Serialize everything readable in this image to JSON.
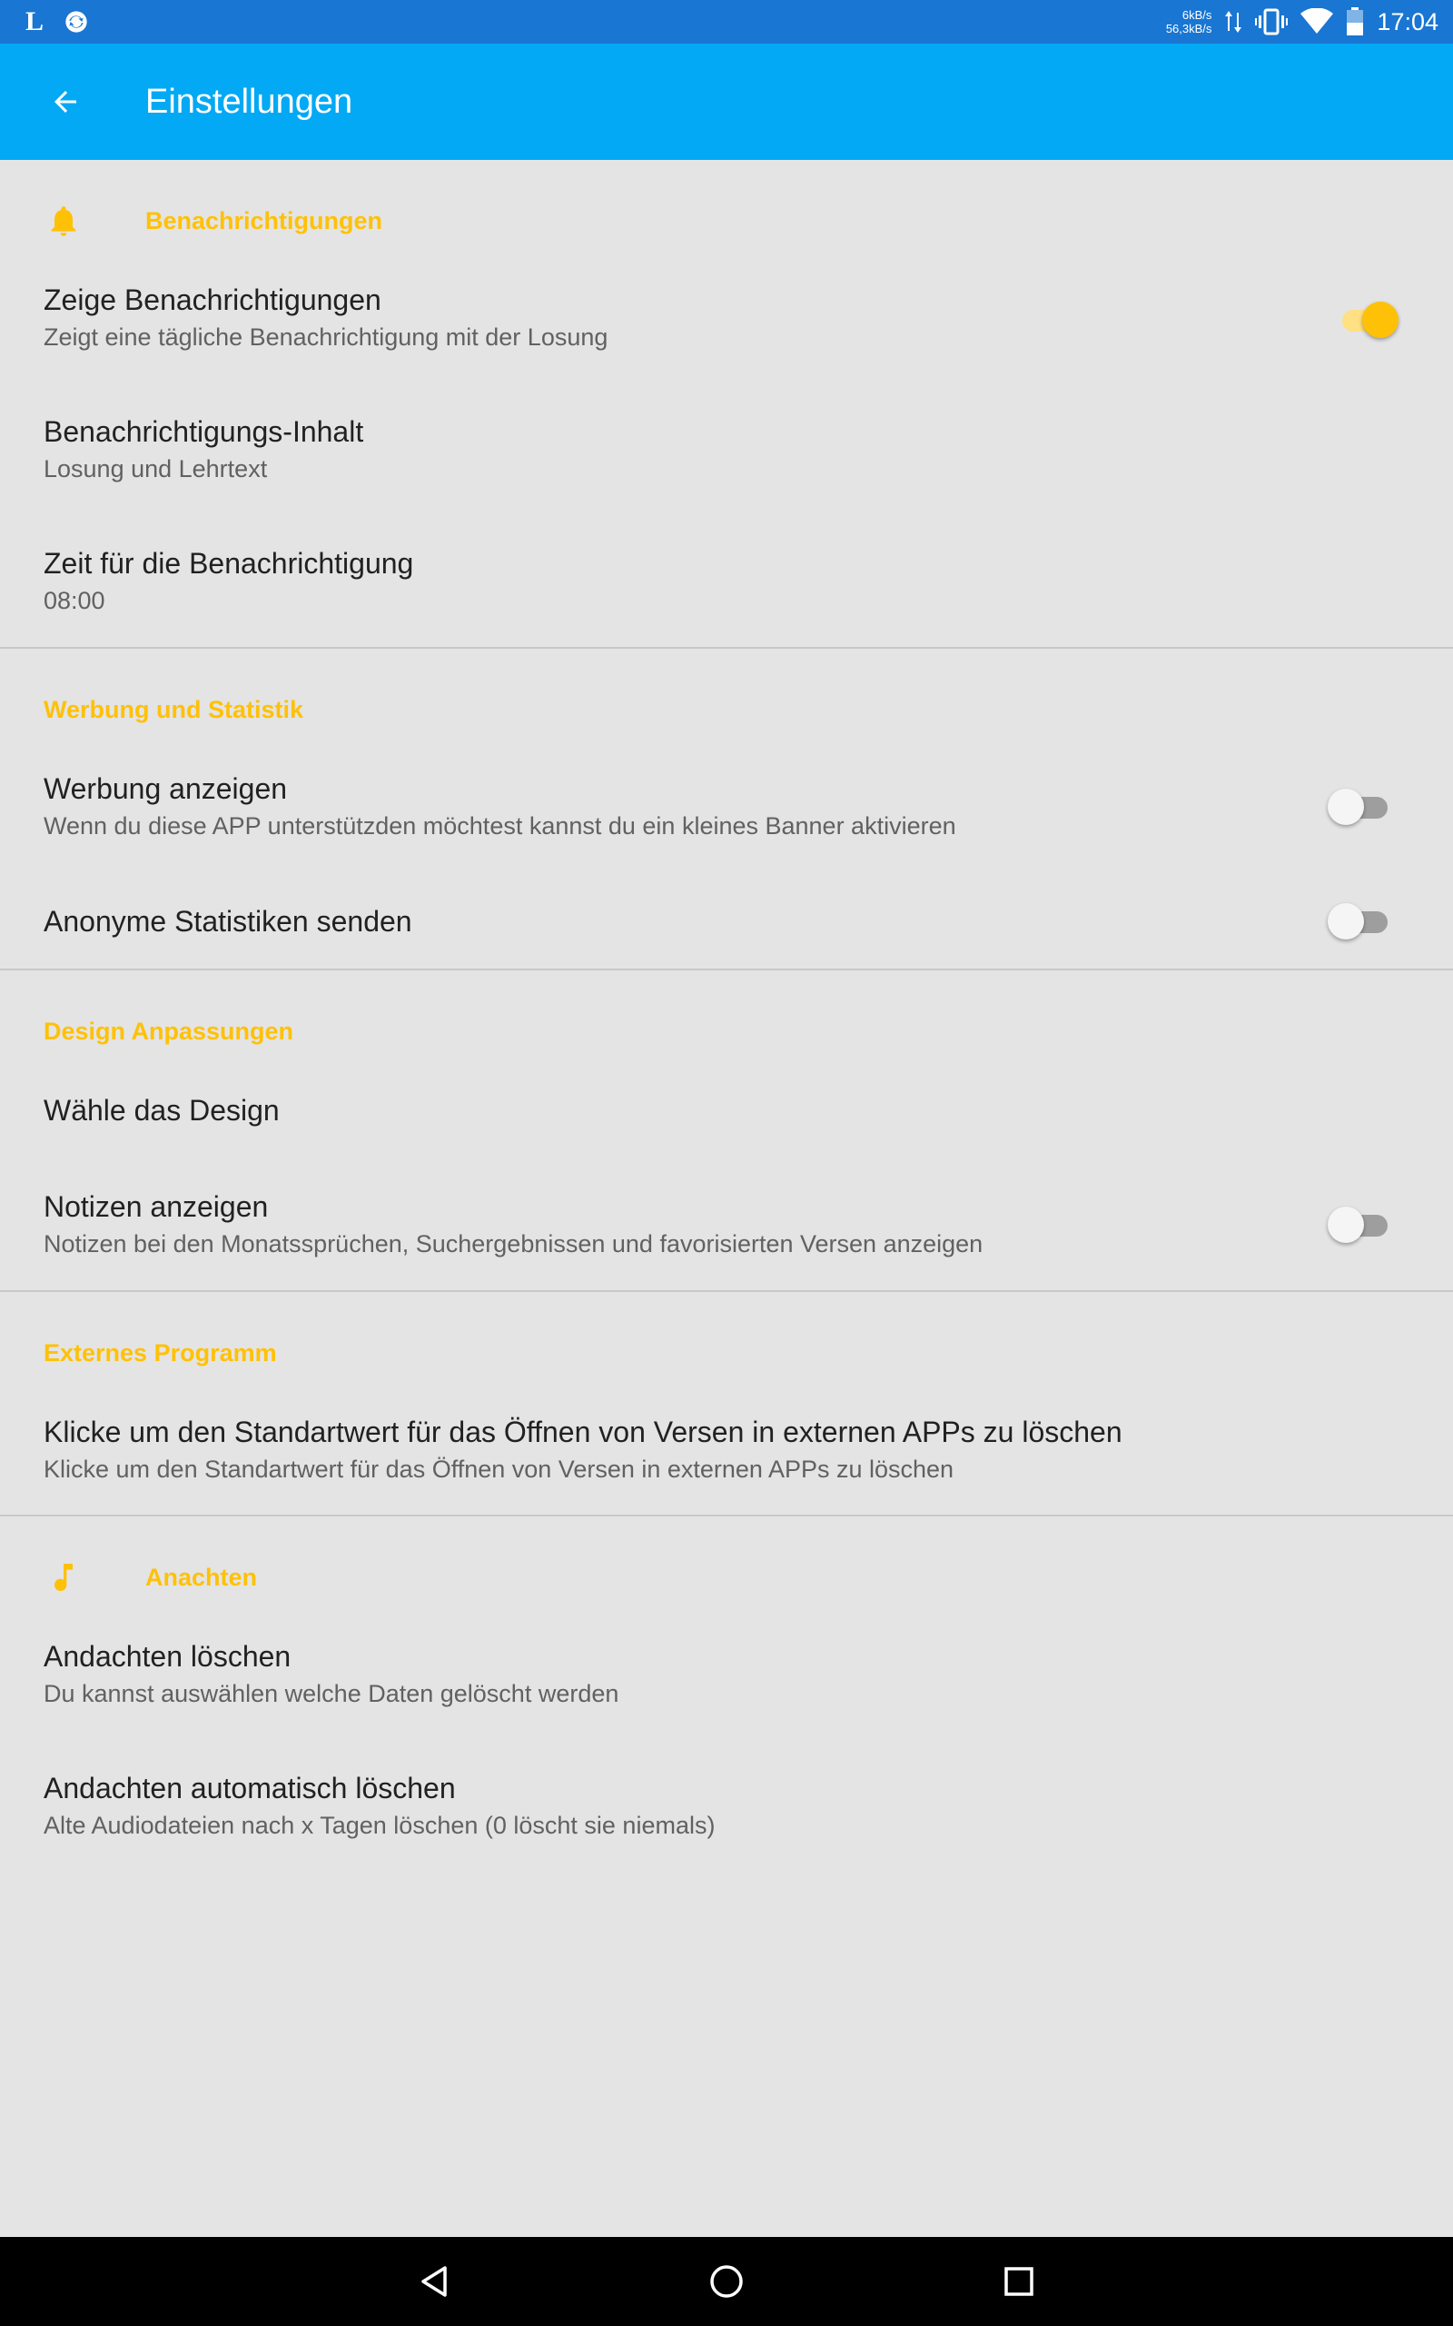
{
  "status_bar": {
    "left_icons": [
      "l-app-icon",
      "sync-icon"
    ],
    "speed_up": "6kB/s",
    "speed_down": "56,3kB/s",
    "icons": [
      "data-arrows-icon",
      "vibrate-icon",
      "wifi-icon",
      "battery-icon"
    ],
    "time": "17:04"
  },
  "app_bar": {
    "back_icon": "arrow-back-icon",
    "title": "Einstellungen",
    "background": "#03a9f4"
  },
  "accent_color": "#ffc107",
  "sections": {
    "notifications": {
      "header": "Benachrichtigungen",
      "icon": "bell-icon",
      "items": [
        {
          "title": "Zeige Benachrichtigungen",
          "summary": "Zeigt eine tägliche Benachrichtigung mit der Losung",
          "switch_on": true
        },
        {
          "title": "Benachrichtigungs-Inhalt",
          "summary": "Losung und Lehrtext"
        },
        {
          "title": "Zeit für die Benachrichtigung",
          "summary": "08:00"
        }
      ]
    },
    "ads": {
      "header": "Werbung und Statistik",
      "items": [
        {
          "title": "Werbung anzeigen",
          "summary": "Wenn du diese APP unterstützden möchtest kannst du ein kleines Banner aktivieren",
          "switch_on": false
        },
        {
          "title": "Anonyme Statistiken senden",
          "switch_on": false
        }
      ]
    },
    "design": {
      "header": "Design Anpassungen",
      "items": [
        {
          "title": "Wähle das Design"
        },
        {
          "title": "Notizen anzeigen",
          "summary": "Notizen bei den Monatssprüchen, Suchergebnissen und favorisierten Versen anzeigen",
          "switch_on": false
        }
      ]
    },
    "external": {
      "header": "Externes Programm",
      "items": [
        {
          "title": "Klicke um den Standartwert für das Öffnen von Versen in externen APPs zu löschen",
          "summary": "Klicke um den Standartwert für das Öffnen von Versen in externen APPs zu löschen"
        }
      ]
    },
    "devotions": {
      "header": "Anachten",
      "icon": "music-note-icon",
      "items": [
        {
          "title": "Andachten löschen",
          "summary": "Du kannst auswählen welche Daten gelöscht werden"
        },
        {
          "title": "Andachten automatisch löschen",
          "summary": "Alte Audiodateien nach x Tagen löschen (0 löscht sie niemals)"
        }
      ]
    }
  },
  "nav_bar": {
    "buttons": [
      "back-triangle-icon",
      "home-circle-icon",
      "recents-square-icon"
    ]
  }
}
